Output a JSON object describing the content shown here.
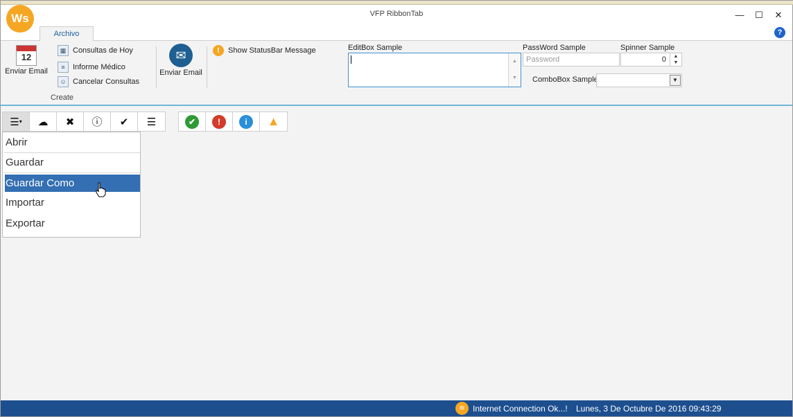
{
  "window": {
    "title": "VFP RibbonTab",
    "logo_text": "Ws",
    "controls": {
      "minimize": "—",
      "maximize": "☐",
      "close": "✕"
    }
  },
  "tabs": [
    {
      "label": "Archivo",
      "active": true
    }
  ],
  "help": {
    "label": "?"
  },
  "ribbon": {
    "group_create": {
      "label": "Create",
      "big_button": {
        "label": "Enviar Email",
        "icon": "calendar-icon",
        "icon_text": "12"
      },
      "items": [
        {
          "label": "Consultas de Hoy",
          "icon": "calendar-small-icon"
        },
        {
          "label": "Informe Médico",
          "icon": "report-icon"
        },
        {
          "label": "Cancelar Consultas",
          "icon": "users-icon"
        }
      ]
    },
    "email_button": {
      "label": "Enviar Email",
      "icon": "envelope-icon"
    },
    "status_message": {
      "label": "Show StatusBar Message",
      "icon": "warning-circle-icon"
    },
    "editbox": {
      "label": "EditBox Sample",
      "value": ""
    },
    "password": {
      "label": "PassWord Sample",
      "placeholder": "Password"
    },
    "spinner": {
      "label": "Spinner Sample",
      "value": "0"
    },
    "combobox": {
      "label": "ComboBox Sample",
      "value": ""
    }
  },
  "toolbar": {
    "group1": [
      "menu-icon",
      "cloud-icon",
      "tools-icon",
      "info-icon",
      "check-icon",
      "list-icon"
    ],
    "group2": [
      "ok-icon",
      "error-icon",
      "info-blue-icon",
      "warning-icon"
    ]
  },
  "menu": {
    "items": [
      {
        "label": "Abrir"
      },
      {
        "label": "Guardar"
      },
      {
        "label": "Guardar Como",
        "selected": true
      },
      {
        "label": "Importar"
      },
      {
        "label": "Exportar"
      }
    ]
  },
  "statusbar": {
    "connection": "Internet Connection Ok...!",
    "datetime": "Lunes, 3 De Octubre  De 2016 09:43:29"
  },
  "colors": {
    "accent": "#336fb2",
    "statusbar": "#1d4f8f",
    "logo": "#f5a623",
    "ribbon_line": "#6fb6d8"
  }
}
